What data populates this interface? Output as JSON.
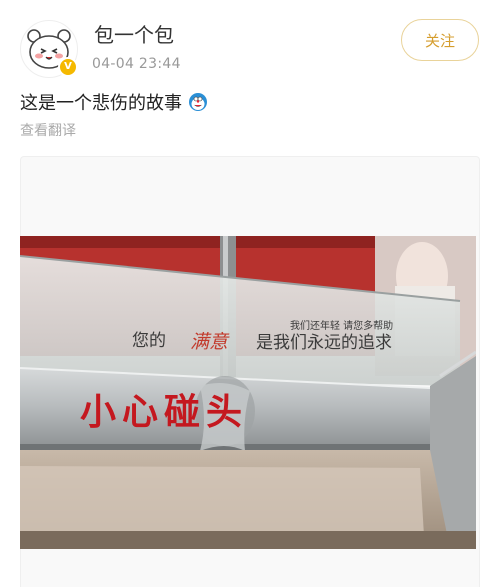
{
  "post": {
    "username": "包一个包",
    "timestamp": "04-04 23:44",
    "follow_label": "关注",
    "text": "这是一个悲伤的故事",
    "translate_label": "查看翻译",
    "emoji_icon": "doraemon-face-icon",
    "verified_icon": "verified-badge-icon"
  },
  "photo": {
    "sign_main": "小心碰头",
    "sign_slogan_left": "您的",
    "sign_slogan_right": "是我们永远的追求",
    "sign_slogan_top": "我们还年轻  请您多帮助",
    "colors": {
      "sign_red": "#c4181f",
      "wall_red": "#b7322e",
      "steel": "#b9bdbf"
    }
  }
}
